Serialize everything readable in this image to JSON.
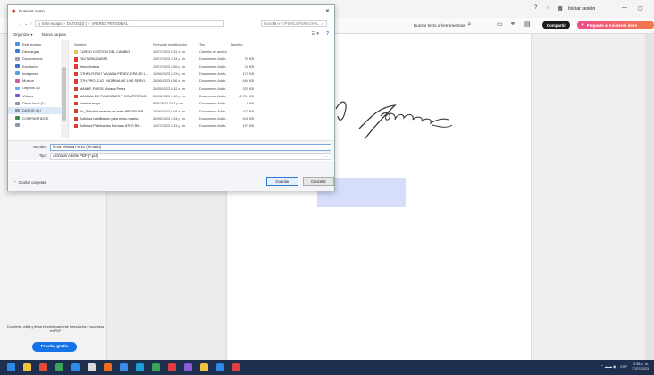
{
  "app": {
    "signin_label": "Iniciar sesión",
    "search_tools_label": "Buscar texto o herramientas",
    "share_label": "Compartir",
    "ai_label": "Pregunte al Asistente de IA",
    "promo_text": "Convierte, edita y firma electrónicamente formularios y acuerdos en PDF",
    "trial_label": "Prueba gratis"
  },
  "dialog": {
    "title": "Guardar como",
    "breadcrumb": [
      "Este equipo",
      "DATOS (D:)",
      "VPEREZ PERSONAL"
    ],
    "search_placeholder": "Buscar en VPEREZ PERSONAL",
    "organize_label": "Organizar ▾",
    "new_folder_label": "Nueva carpeta",
    "nav_items": [
      {
        "label": "Este equipo",
        "color": "#4a8fd8"
      },
      {
        "label": "Descargas",
        "color": "#3a7fd1"
      },
      {
        "label": "Documentos",
        "color": "#9aa5b5"
      },
      {
        "label": "Escritorio",
        "color": "#3f6fc2"
      },
      {
        "label": "Imágenes",
        "color": "#5aa0e0"
      },
      {
        "label": "Música",
        "color": "#d45c9a"
      },
      {
        "label": "Objetos 3D",
        "color": "#6cb0e8"
      },
      {
        "label": "Videos",
        "color": "#7b56c8"
      },
      {
        "label": "Disco local (C:)",
        "color": "#8a97a8"
      },
      {
        "label": "DATOS (D:)",
        "color": "#8a97a8"
      },
      {
        "label": "COMPARTIDOS",
        "color": "#3c8a52"
      },
      {
        "label": "...",
        "color": "#8a97a8"
      }
    ],
    "columns": [
      "Nombre",
      "Fecha de modificación",
      "Tipo",
      "Tamaño"
    ],
    "files": [
      {
        "name": "CURSO GESTION DEL CAMBIO",
        "date": "10/07/2023 8:31 a. m.",
        "type": "Carpeta de archivos",
        "size": "",
        "kind": "folder"
      },
      {
        "name": "FACTURA GAFAS",
        "date": "10/07/2023 2:34 p. m.",
        "type": "Documento Adob...",
        "size": "32 KB",
        "kind": "pdf"
      },
      {
        "name": "firma Viviana",
        "date": "17/07/2023 2:56 p. m.",
        "type": "Documento Adob...",
        "size": "23 KB",
        "kind": "pdf"
      },
      {
        "name": "OTHRI-FOR07 VIVIANA PEREZ- EPA DE L...",
        "date": "16/06/2023 2:23 p. m.",
        "type": "Documento Adob...",
        "size": "170 KB",
        "kind": "pdf"
      },
      {
        "name": "OTH-PRO12-IG - NOMINA DE LOS SERVI...",
        "date": "25/06/2023 8:56 a. m.",
        "type": "Documento Adob...",
        "size": "469 KB",
        "kind": "pdf"
      },
      {
        "name": "MANDF-FOR31 Viviana Perez",
        "date": "26/05/2023 8:32 a. m.",
        "type": "Documento Adob...",
        "size": "332 KB",
        "kind": "pdf"
      },
      {
        "name": "MANUAL DE FUNCIONES Y COMPETENC...",
        "date": "26/05/2023 1:40 p. m.",
        "type": "Documento Adob...",
        "size": "2.701 KB",
        "kind": "pdf"
      },
      {
        "name": "Nomina mayo",
        "date": "8/06/2023 2:47 p. m.",
        "type": "Documento Adob...",
        "size": "8 KB",
        "kind": "pdf"
      },
      {
        "name": "Rc_Solicitud revisión de adds PRIORITAR...",
        "date": "26/06/2023 8:08 a. m.",
        "type": "Documento Adob...",
        "size": "477 KB",
        "kind": "pdf"
      },
      {
        "name": "Solicitud habilitación para envío masivo",
        "date": "25/06/2023 4:24 p. m.",
        "type": "Documento Adob...",
        "size": "443 KB",
        "kind": "pdf"
      },
      {
        "name": "Solicitud Publicación Formato 87FO RO...",
        "date": "10/07/2023 2:31 p. m.",
        "type": "Documento Adob...",
        "size": "197 KB",
        "kind": "pdf"
      }
    ],
    "filename_label": "Nombre:",
    "filename_value": "firma Viviana Perez (firmado)",
    "filetype_label": "Tipo:",
    "filetype_value": "Archivos Adobe PDF (*.pdf)",
    "hide_folders_label": "Ocultar carpetas",
    "save_label": "Guardar",
    "cancel_label": "Cancelar"
  },
  "taskbar": {
    "icons": [
      "#2f88ea",
      "#f0c33c",
      "#e44a3a",
      "#3aa55a",
      "#2f88ea",
      "#d9d9d9",
      "#f06d1f",
      "#3c8ae8",
      "#1aa0d8",
      "#3aa55a",
      "#e23b3b",
      "#8a5cd6",
      "#f0c33c",
      "#2f88ea",
      "#e04040"
    ],
    "tray_lang": "ESP",
    "time": "2:58 p. m.",
    "date": "17/07/2023"
  }
}
